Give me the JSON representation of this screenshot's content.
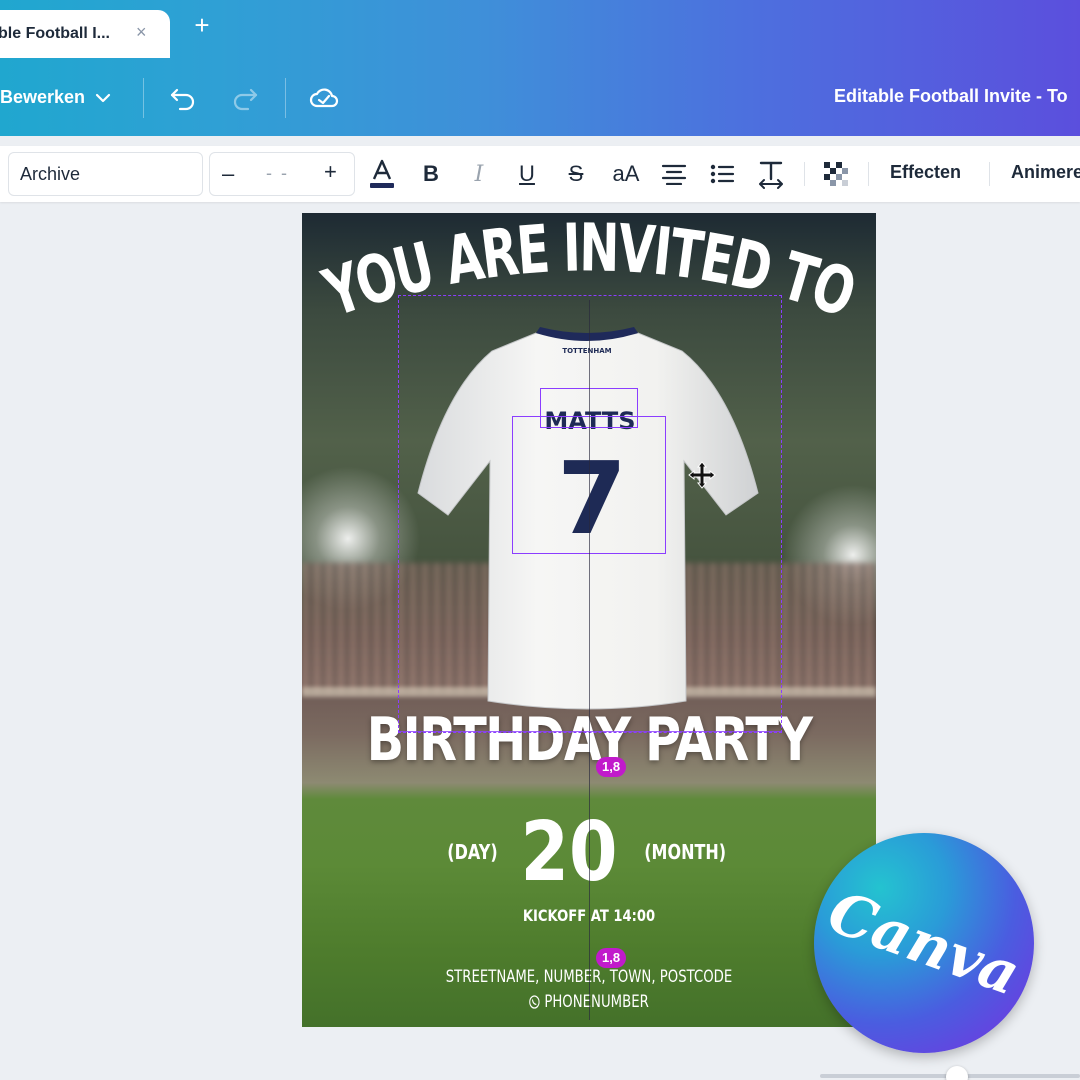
{
  "tab": {
    "title": "ble Football I...",
    "close": "×",
    "new_tab": "+"
  },
  "header": {
    "edit_menu": "Bewerken",
    "document_title": "Editable Football Invite - To"
  },
  "toolbar": {
    "font_name": "Archive",
    "font_size_minus": "–",
    "font_size_value": "- -",
    "font_size_plus": "+",
    "bold": "B",
    "italic": "I",
    "underline": "U",
    "strike": "S",
    "case": "aA",
    "effects": "Effecten",
    "animate": "Animeren"
  },
  "design": {
    "headline_top": "YOU ARE INVITED TO",
    "shirt_brand": "TOTTENHAM",
    "shirt_name": "MATTS",
    "shirt_number": "7",
    "headline_bottom": "BIRTHDAY PARTY",
    "day_label": "(DAY)",
    "day_number": "20",
    "month_label": "(MONTH)",
    "kickoff": "KICKOFF AT 14:00",
    "address": "STREETNAME, NUMBER, TOWN, POSTCODE",
    "phone": "PHONENUMBER"
  },
  "spacing_badges": [
    "1,8",
    "1,8"
  ],
  "logo": {
    "text": "Canva"
  },
  "colors": {
    "accent": "#8b3dff",
    "badge": "#c11acb",
    "shirt_text": "#1e2a55"
  }
}
